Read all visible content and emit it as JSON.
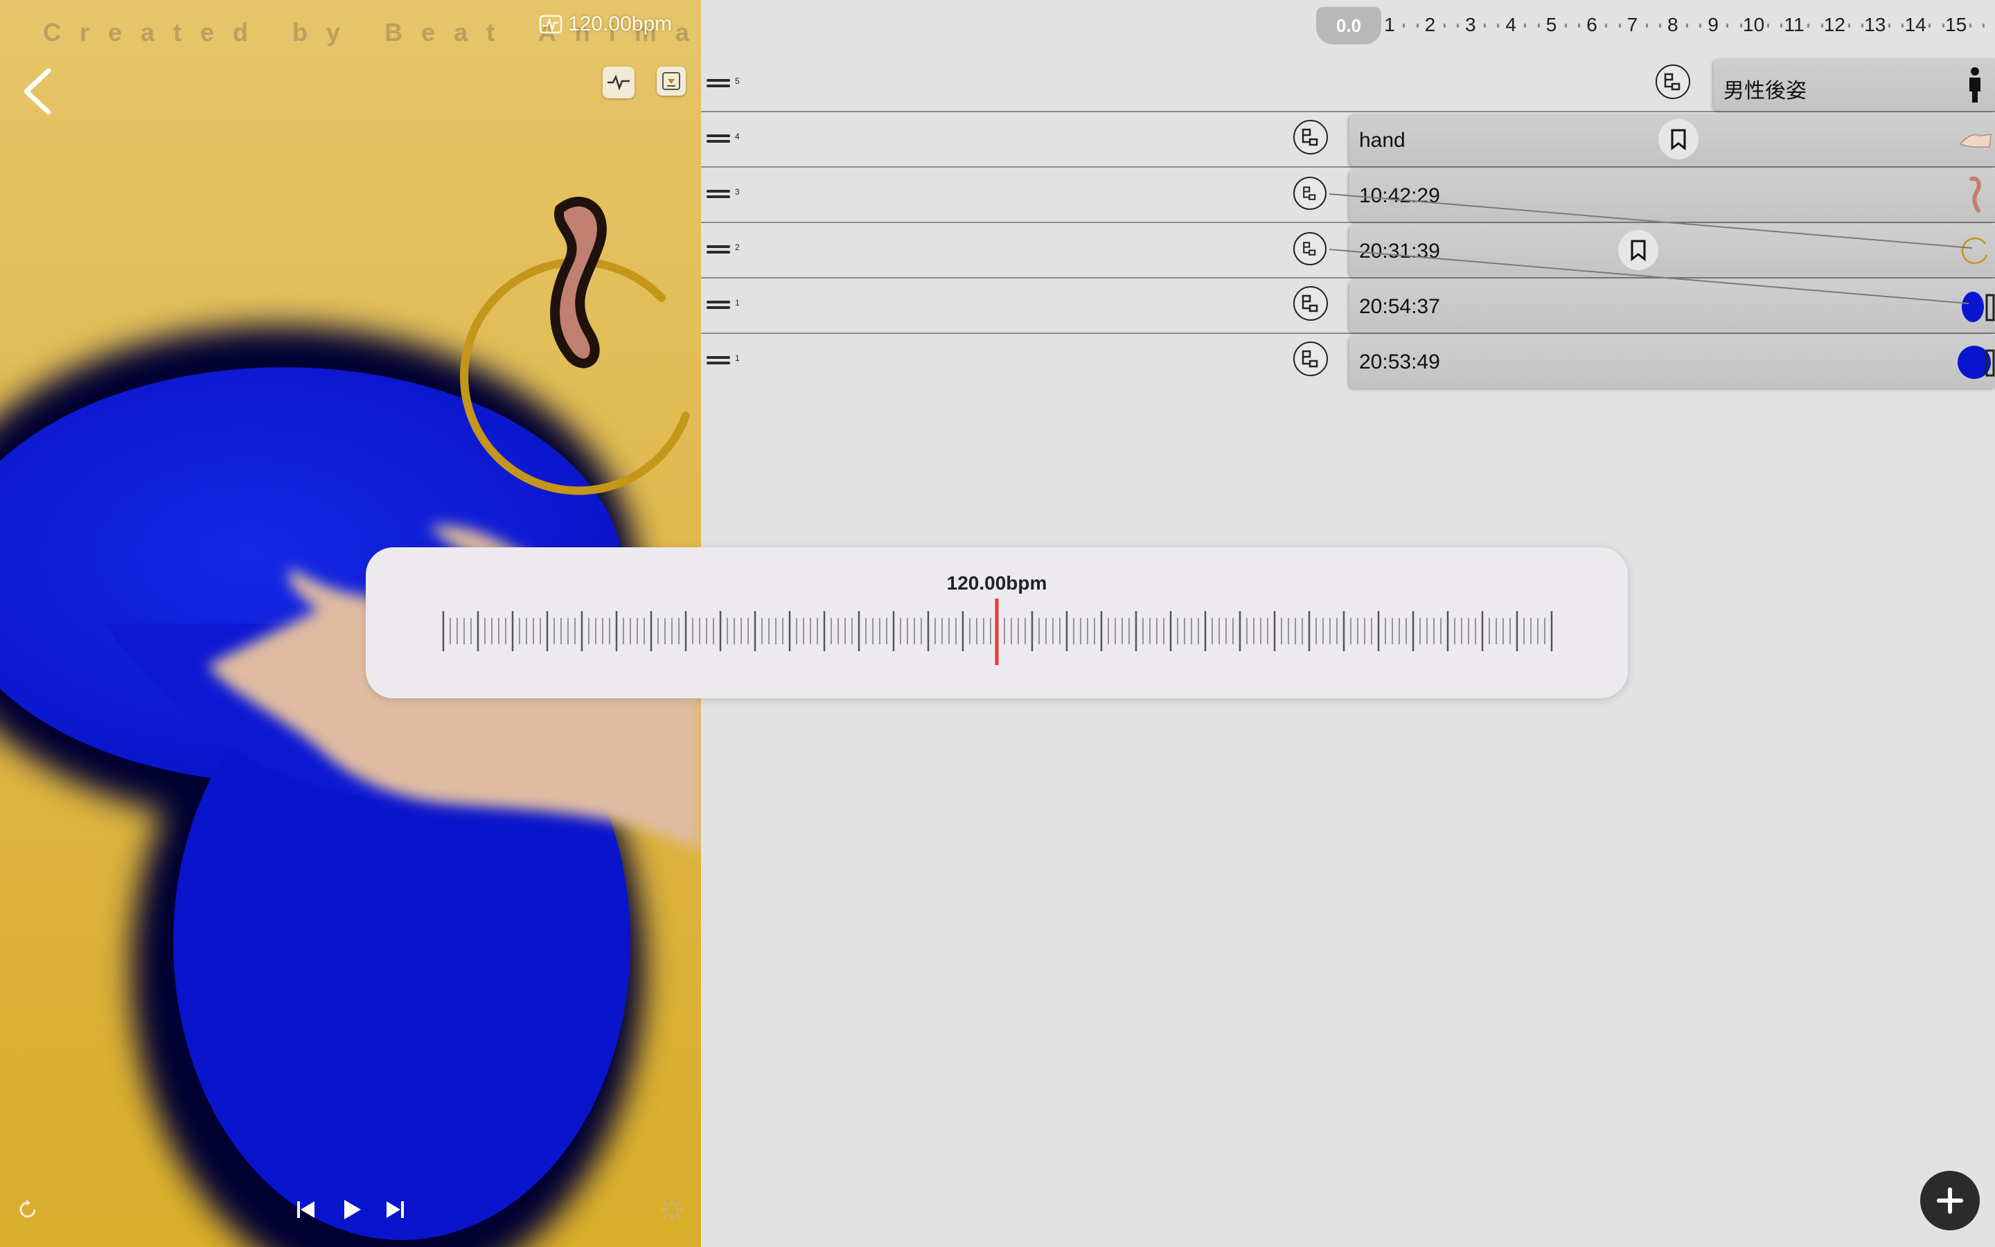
{
  "preview": {
    "watermark": "Created by Beat Animator",
    "bpm_badge": "120.00bpm",
    "icons": {
      "back": "chevron-left-icon",
      "waveform": "waveform-icon",
      "export": "download-box-icon",
      "loop": "loop-icon",
      "skip_back": "skip-back-icon",
      "play": "play-icon",
      "skip_forward": "skip-forward-icon",
      "settings": "sparkle-icon"
    },
    "colors": {
      "background": "#e2bd55",
      "blob": "#0a15cf",
      "ring": "#c4961a",
      "worm": "#c08070"
    }
  },
  "ruler": {
    "playhead_label": "0.0",
    "numbers": [
      "1",
      "2",
      "3",
      "4",
      "5",
      "6",
      "7",
      "8",
      "9",
      "10",
      "11",
      "12",
      "13",
      "14",
      "15"
    ]
  },
  "rows": [
    {
      "index": "5",
      "label": "男性後姿",
      "thumb": "person-silhouette"
    },
    {
      "index": "4",
      "label": "hand",
      "thumb": "hand"
    },
    {
      "index": "3",
      "label": "10:42:29",
      "thumb": "brown-worm"
    },
    {
      "index": "2",
      "label": "20:31:39",
      "thumb": "gold-ring"
    },
    {
      "index": "1",
      "label": "20:54:37",
      "thumb": "blue-oval"
    },
    {
      "index": "1",
      "label": "20:53:49",
      "thumb": "blue-circle"
    }
  ],
  "bpm_dial": {
    "value": "120.00bpm",
    "accent": "#e53935"
  },
  "fab": {
    "icon": "plus-icon"
  }
}
